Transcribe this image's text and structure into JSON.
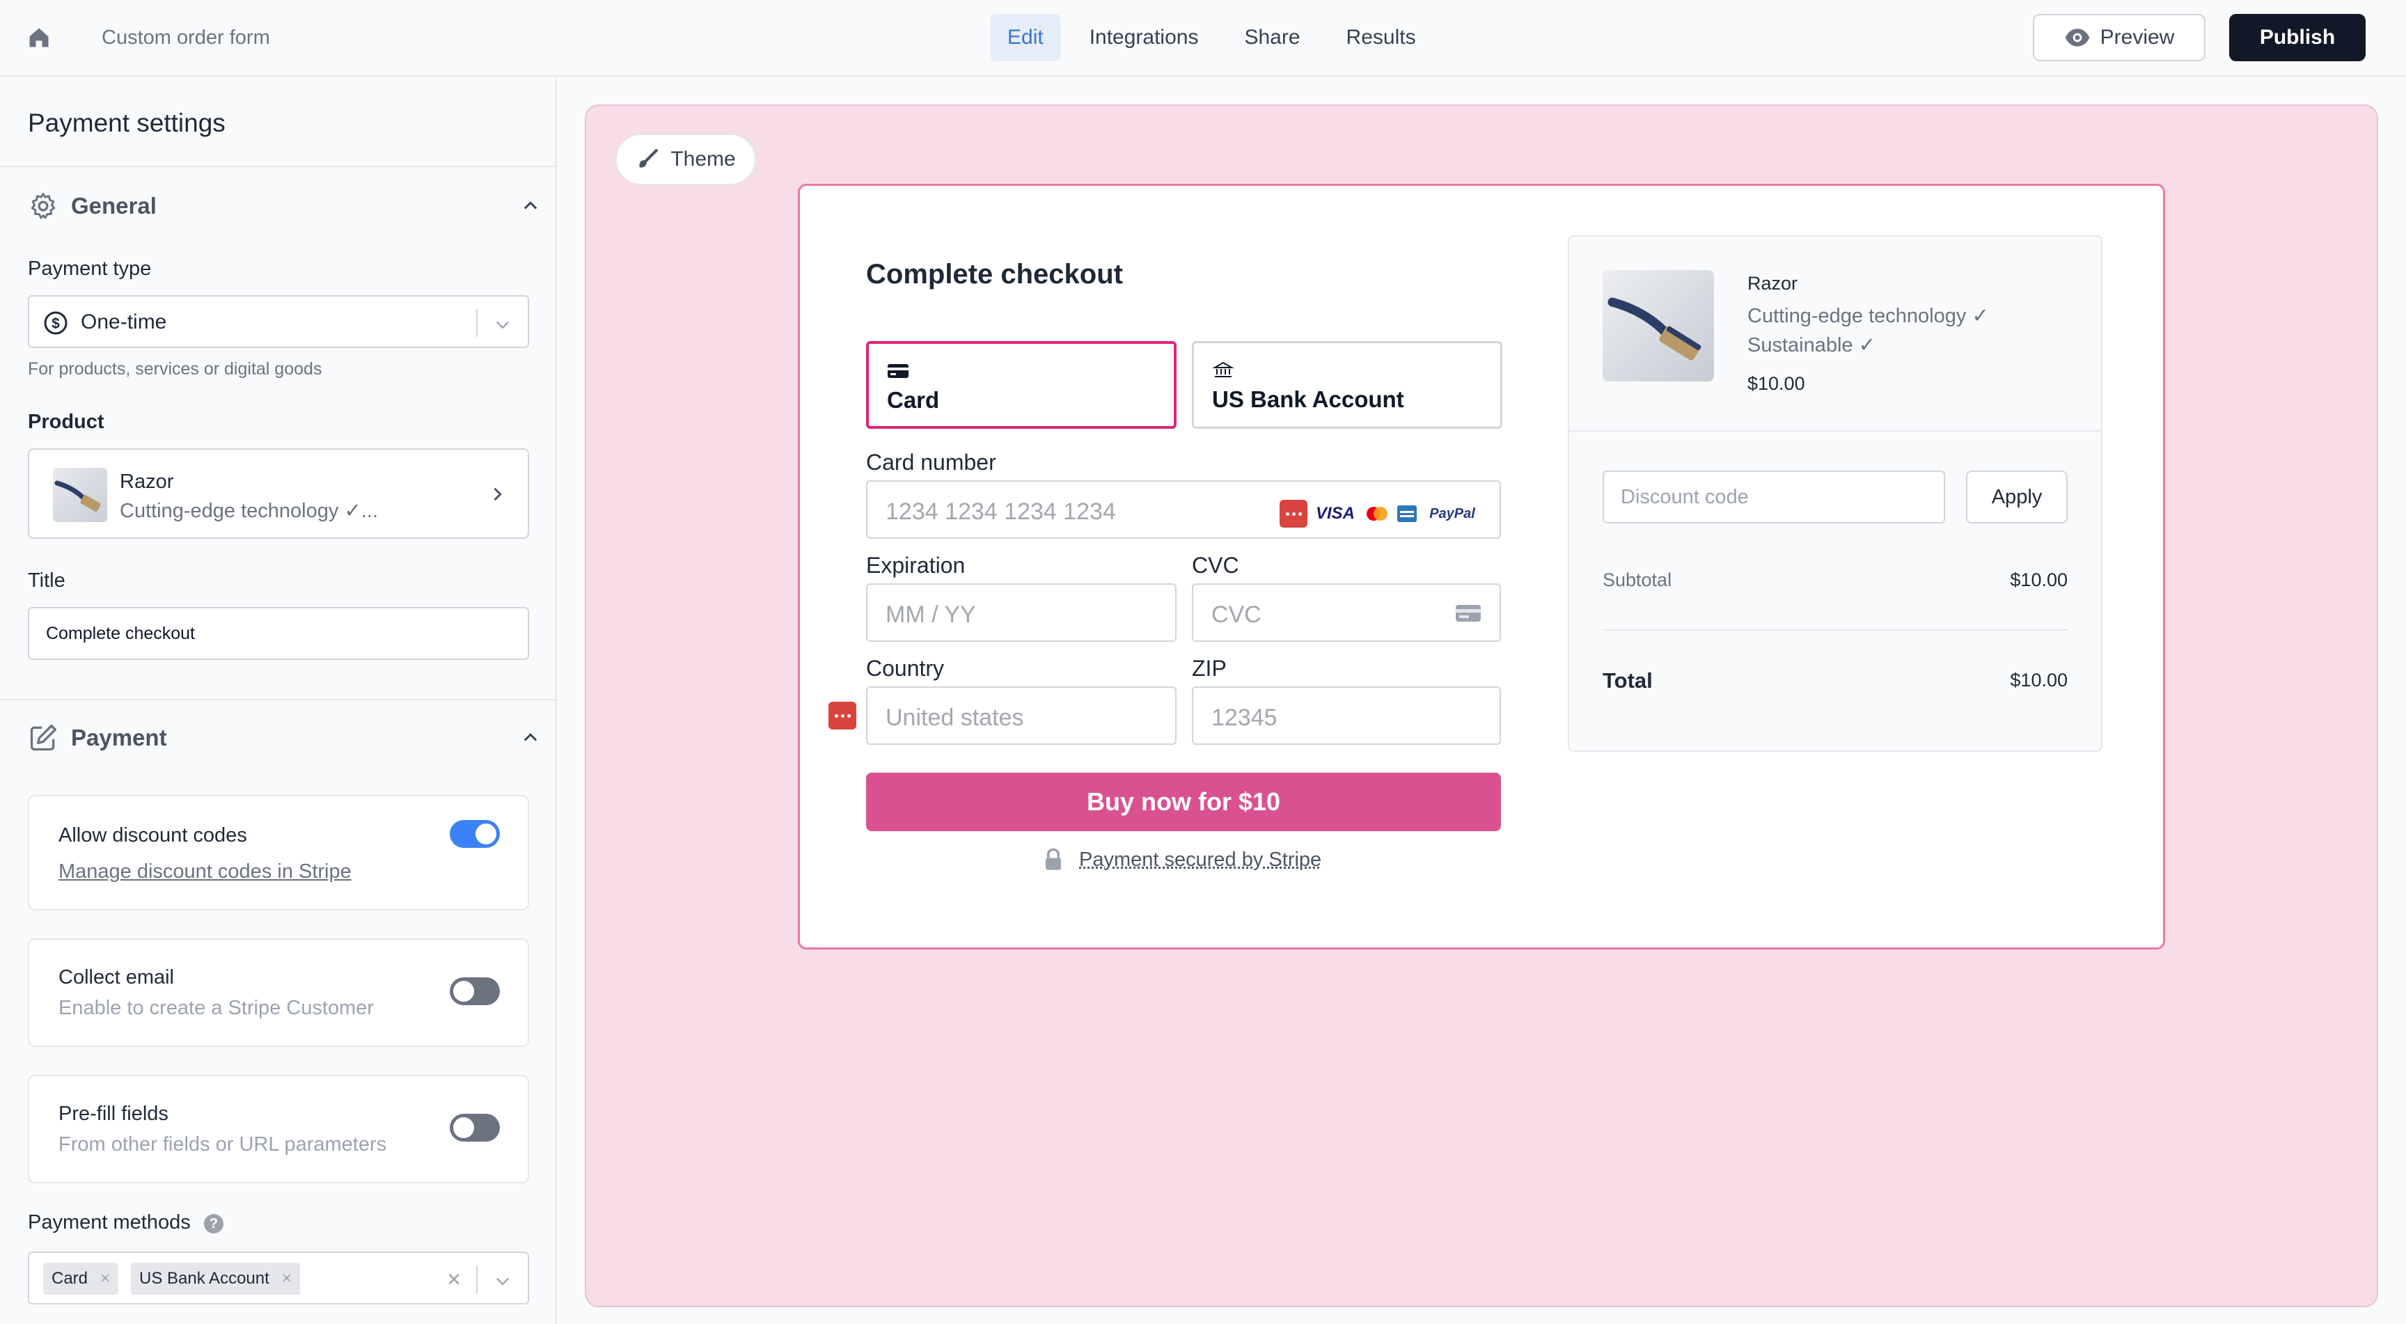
{
  "header": {
    "form_name": "Custom order form",
    "tabs": [
      {
        "label": "Edit",
        "active": true
      },
      {
        "label": "Integrations",
        "active": false
      },
      {
        "label": "Share",
        "active": false
      },
      {
        "label": "Results",
        "active": false
      }
    ],
    "preview_label": "Preview",
    "publish_label": "Publish"
  },
  "sidebar": {
    "title": "Payment settings",
    "general": {
      "heading": "General",
      "payment_type_label": "Payment type",
      "payment_type_value": "One-time",
      "payment_type_hint": "For products, services or digital goods",
      "product_label": "Product",
      "product_name": "Razor",
      "product_desc": "Cutting-edge technology ✓...",
      "title_label": "Title",
      "title_value": "Complete checkout"
    },
    "payment": {
      "heading": "Payment",
      "toggles": [
        {
          "title": "Allow discount codes",
          "subtitle": "Manage discount codes in Stripe",
          "on": true
        },
        {
          "title": "Collect email",
          "subtitle": "Enable to create a Stripe Customer",
          "on": false
        },
        {
          "title": "Pre-fill fields",
          "subtitle": "From other fields or URL parameters",
          "on": false
        }
      ],
      "methods_label": "Payment methods",
      "methods_help": "?",
      "methods": [
        "Card",
        "US Bank Account"
      ],
      "clear_glyph": "×"
    }
  },
  "canvas": {
    "theme_label": "Theme",
    "checkout": {
      "title": "Complete checkout",
      "tab_card": "Card",
      "tab_bank": "US Bank Account",
      "card_number_label": "Card number",
      "card_number_placeholder": "1234 1234 1234 1234",
      "brands": [
        "VISA",
        "PayPal"
      ],
      "expiration_label": "Expiration",
      "expiration_placeholder": "MM / YY",
      "cvc_label": "CVC",
      "cvc_placeholder": "CVC",
      "country_label": "Country",
      "country_placeholder": "United states",
      "zip_label": "ZIP",
      "zip_placeholder": "12345",
      "buy_label": "Buy now for $10",
      "secured_label": "Payment secured by Stripe"
    },
    "summary": {
      "product_name": "Razor",
      "features": [
        "Cutting-edge technology ✓",
        "Sustainable ✓"
      ],
      "price": "$10.00",
      "discount_placeholder": "Discount code",
      "apply_label": "Apply",
      "subtotal_label": "Subtotal",
      "subtotal_value": "$10.00",
      "total_label": "Total",
      "total_value": "$10.00"
    }
  },
  "colors": {
    "accent_pink": "#db2777",
    "buy_button": "#d9528f",
    "canvas_bg": "#f6dde8",
    "toggle_on": "#3b82f6",
    "tab_active": "#3b76c6"
  }
}
